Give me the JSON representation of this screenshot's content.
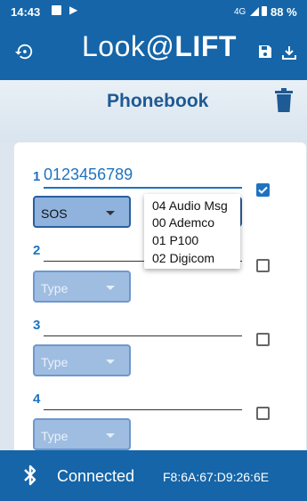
{
  "status_bar": {
    "time": "14:43",
    "network": "4G",
    "battery": "88 %"
  },
  "app_bar": {
    "logo_prefix": "Look@",
    "logo_suffix": "LIFT",
    "left_icon": "history-icon",
    "right_icons": [
      "save-icon",
      "download-icon"
    ]
  },
  "page": {
    "title": "Phonebook",
    "delete_icon": "trash-icon"
  },
  "entries": [
    {
      "number": "1",
      "phone": "0123456789",
      "type": "SOS",
      "checked": true
    },
    {
      "number": "2",
      "phone": "",
      "type": "Type",
      "checked": false
    },
    {
      "number": "3",
      "phone": "",
      "type": "Type",
      "checked": false
    },
    {
      "number": "4",
      "phone": "",
      "type": "Type",
      "checked": false
    }
  ],
  "type_dropdown": {
    "options": [
      "04 Audio Msg",
      "00 Ademco",
      "01 P100",
      "02 Digicom"
    ]
  },
  "bottom_bar": {
    "status": "Connected",
    "device_address": "F8:6A:67:D9:26:6E"
  },
  "colors": {
    "primary": "#1565a8",
    "accent": "#1e73c0",
    "title": "#1e5a94"
  }
}
